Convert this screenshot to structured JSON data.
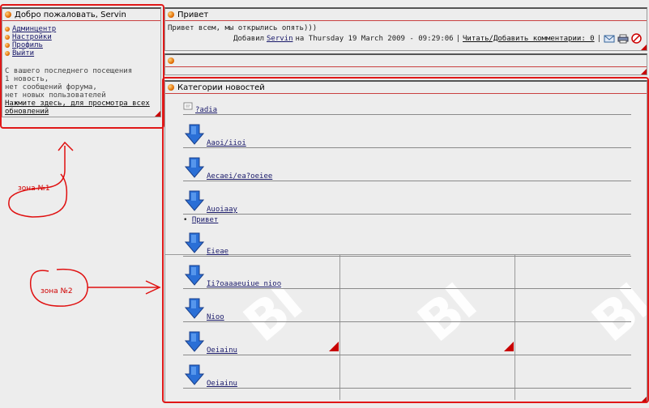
{
  "welcome": {
    "title": "Добро пожаловать, Servin",
    "menu": [
      {
        "label": "Админцентр"
      },
      {
        "label": "Настройки"
      },
      {
        "label": "Профиль"
      },
      {
        "label": "Выйти"
      }
    ],
    "stats": {
      "line1": "С вашего последнего посещения",
      "line2": "1 новость,",
      "line3": "нет сообщений форума,",
      "line4": "нет новых пользователей",
      "link1": "Нажмите здесь, для просмотра всех",
      "link2": "обновлений"
    }
  },
  "news": {
    "title": "Привет",
    "body": "Привет всем, мы открылись опять)))",
    "meta_prefix": "Добавил",
    "author": "Servin",
    "meta_date": "на Thursday 19 March 2009 - 09:29:06",
    "sep": "|",
    "comments_link": "Читать/Добавить комментарии: 0",
    "sep2": "|"
  },
  "categories": {
    "title": "Категории новостей",
    "first_item": "?adia",
    "items": [
      {
        "label": "Aaoi/iioi"
      },
      {
        "label": "Aecaei/ea?oeiee"
      },
      {
        "label": "Auoiaay"
      },
      {
        "label": "Eieae"
      },
      {
        "label": "Ii?oaaaeuiue nioo"
      },
      {
        "label": "Nioo"
      },
      {
        "label": "Oeiainu"
      },
      {
        "label": "Oeiainu"
      }
    ],
    "bullet_item": "Привет"
  },
  "annotations": {
    "zone1": "зона №1",
    "zone2": "зона №2"
  },
  "watermark": {
    "text": "BI"
  },
  "colors": {
    "accent": "#c80000",
    "link": "#1a1a6a",
    "background": "#ededed"
  }
}
